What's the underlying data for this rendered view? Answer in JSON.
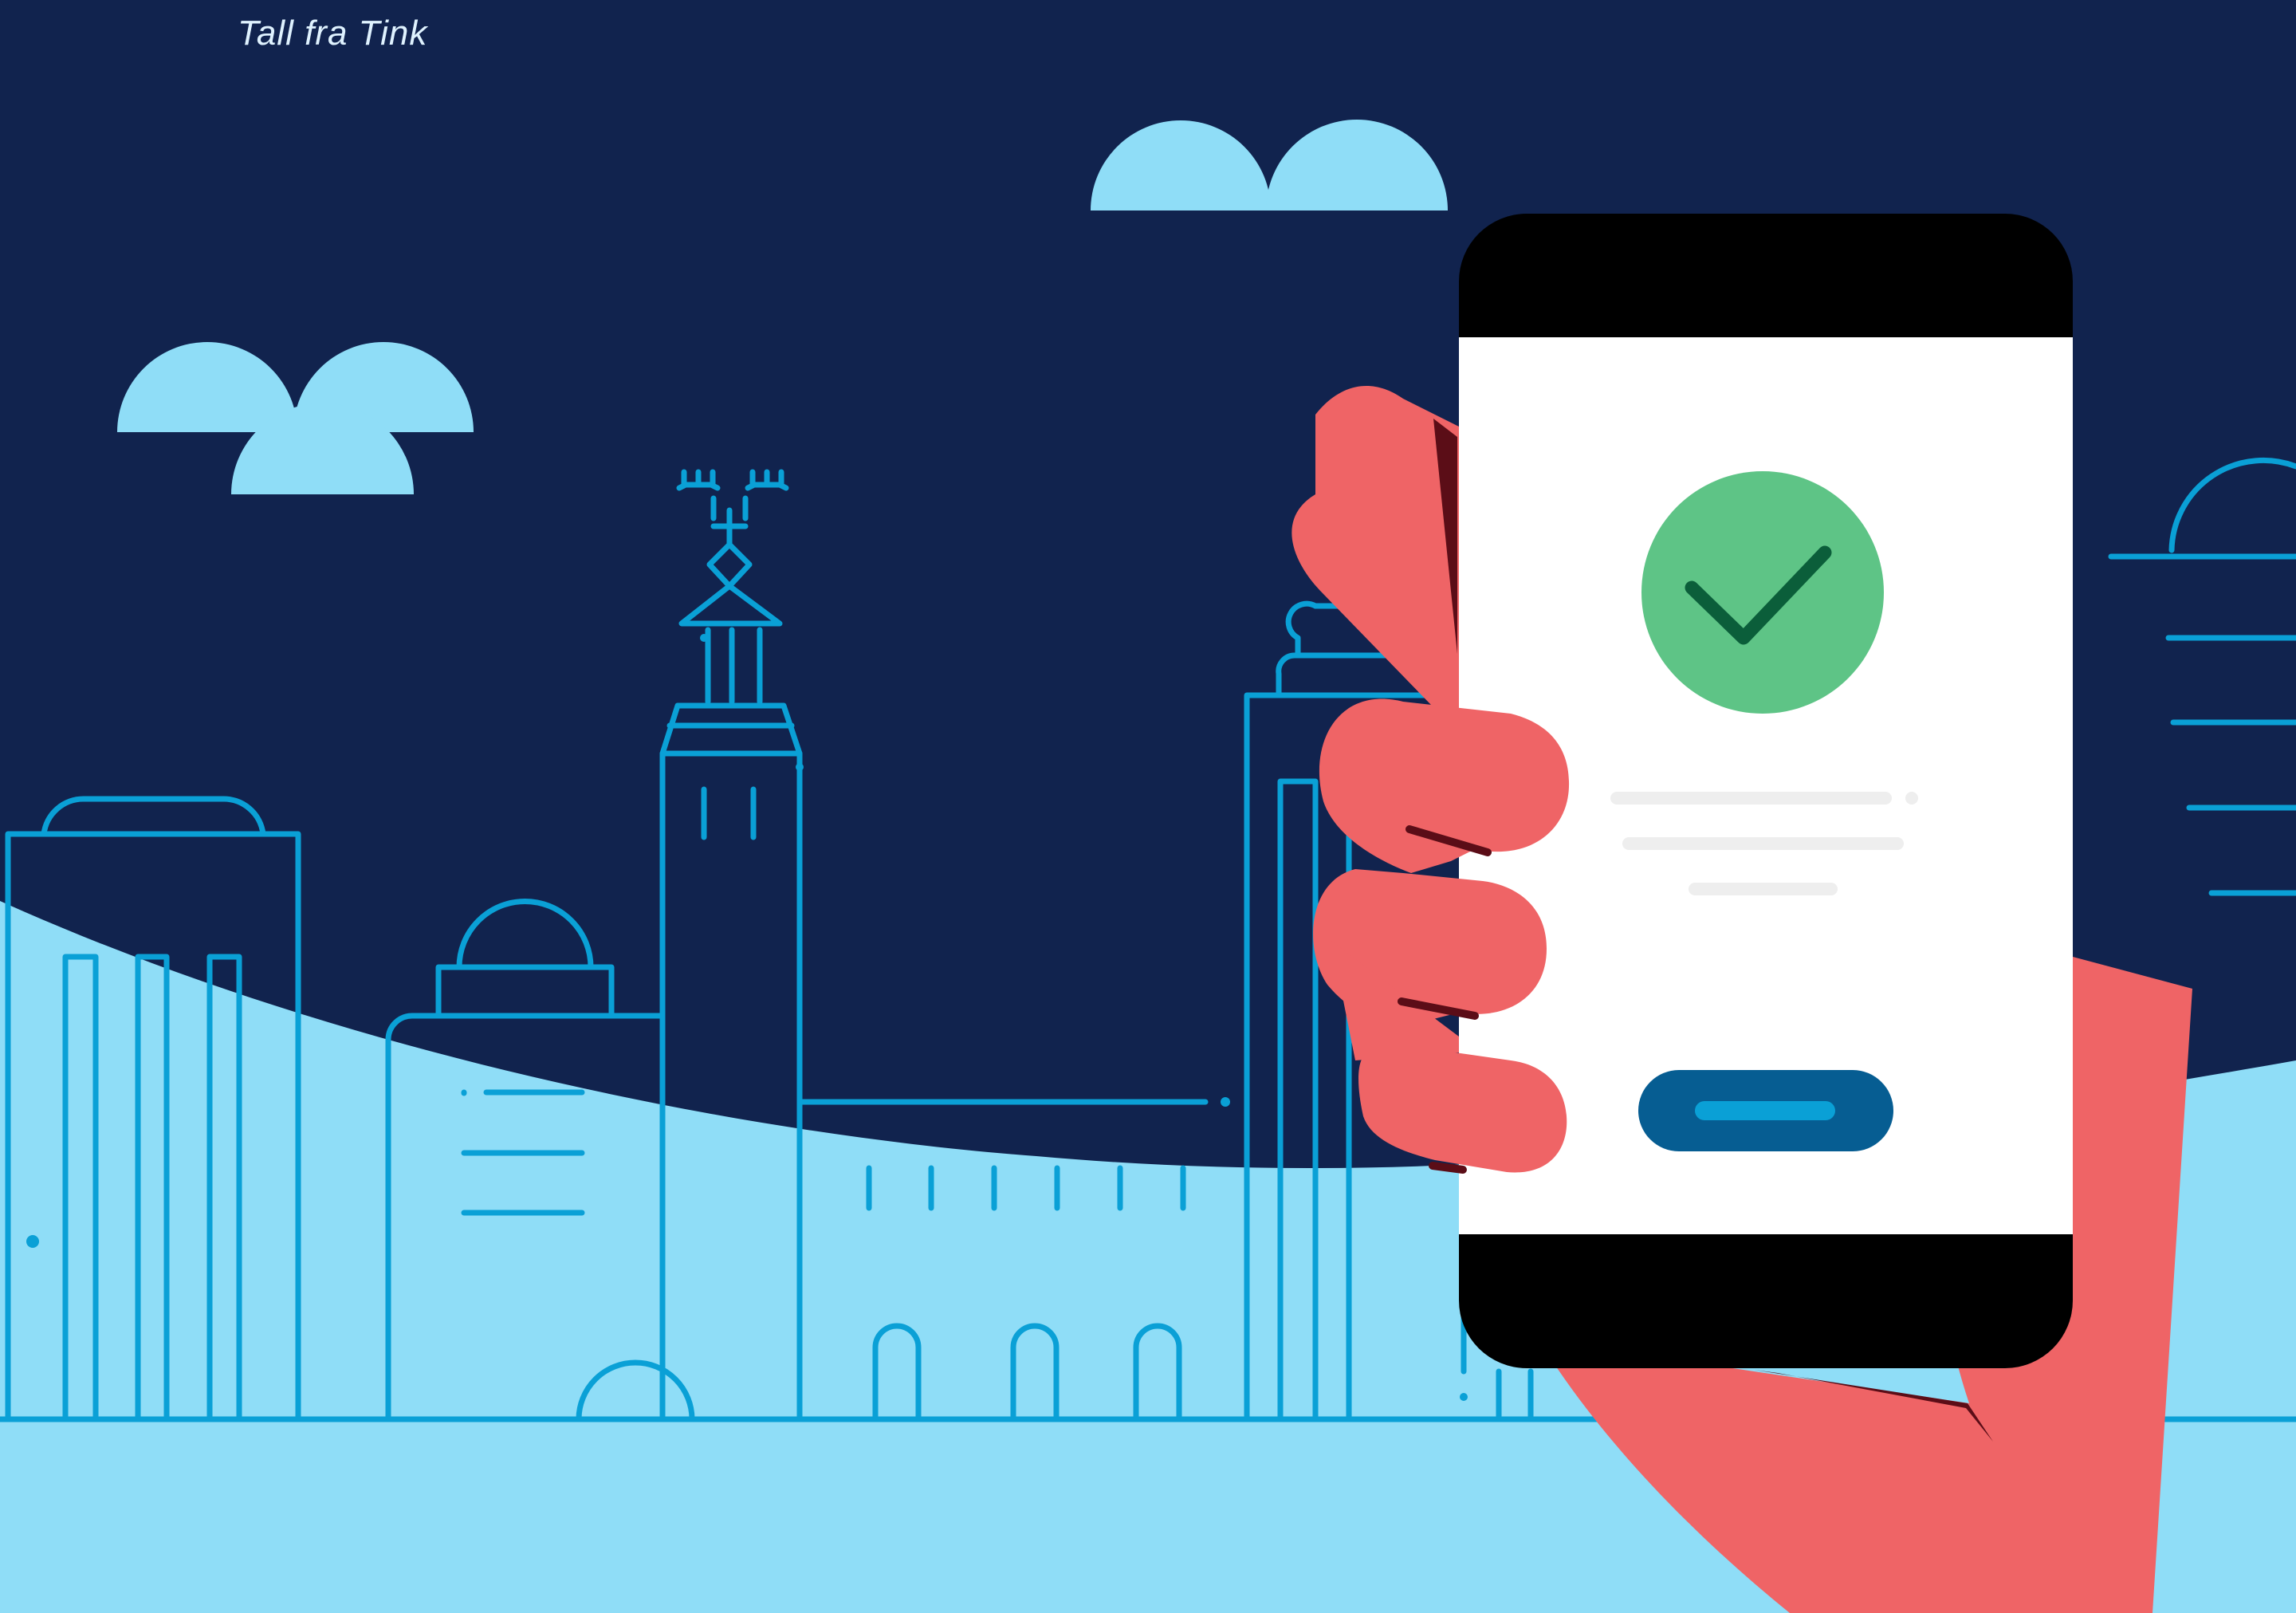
{
  "caption": {
    "text": "Tall fra Tink"
  },
  "colors": {
    "background": "#11234e",
    "cloud": "#8fddf7",
    "ground": "#8fddf7",
    "line": "#0aa0d6",
    "caption": "#dff2ff",
    "hand": "#ef6466",
    "hand_shadow": "#5b0d17",
    "phone_body": "#000000",
    "phone_screen": "#ffffff",
    "check_circle": "#5ec486",
    "check_mark": "#0b5e3a",
    "text_placeholder": "#eeeeee",
    "button_fill": "#065d92",
    "button_bar": "#0aa0d6"
  },
  "icons": {
    "check": "check-icon"
  },
  "phone": {
    "status": "confirmed"
  }
}
